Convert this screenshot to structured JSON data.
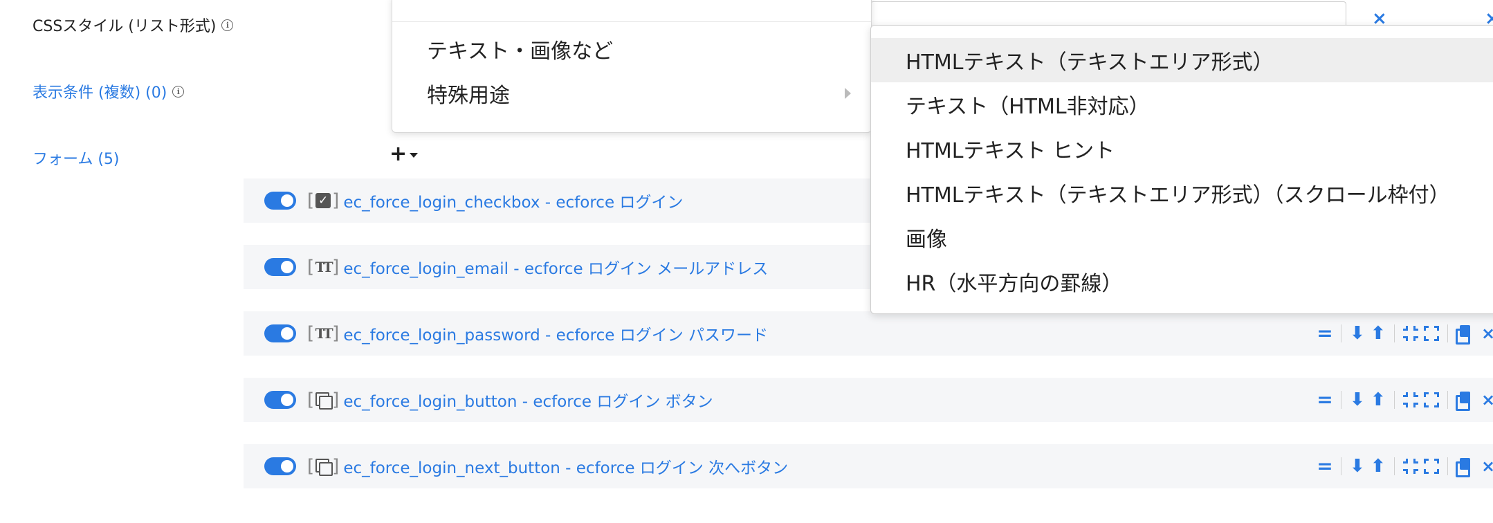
{
  "left_labels": {
    "css_style": "CSSスタイル (リスト形式)",
    "display_conditions": "表示条件 (複数) (0)",
    "forms": "フォーム (5)"
  },
  "icons": {
    "info": "i",
    "close": "×",
    "plus": "+"
  },
  "menu_primary": {
    "items": [
      {
        "label": "テキスト・画像など"
      },
      {
        "label": "特殊用途"
      }
    ]
  },
  "menu_submenu": {
    "items": [
      {
        "label": "HTMLテキスト（テキストエリア形式）",
        "highlighted": true
      },
      {
        "label": "テキスト（HTML非対応）"
      },
      {
        "label": "HTMLテキスト ヒント"
      },
      {
        "label": "HTMLテキスト（テキストエリア形式）（スクロール枠付）"
      },
      {
        "label": "画像"
      },
      {
        "label": "HR（水平方向の罫線）"
      }
    ]
  },
  "form_rows": [
    {
      "icon": "checkbox-icon",
      "label": "ec_force_login_checkbox - ecforce ログイン",
      "enabled": true
    },
    {
      "icon": "text-field-icon",
      "label": "ec_force_login_email - ecforce ログイン メールアドレス",
      "enabled": true
    },
    {
      "icon": "text-field-icon",
      "label": "ec_force_login_password - ecforce ログイン パスワード",
      "enabled": true
    },
    {
      "icon": "button-icon",
      "label": "ec_force_login_button - ecforce ログイン ボタン",
      "enabled": true
    },
    {
      "icon": "button-icon",
      "label": "ec_force_login_next_button - ecforce ログイン 次へボタン",
      "enabled": true
    }
  ],
  "row_actions": {
    "equals": "=",
    "down": "⬇",
    "up": "⬆"
  },
  "colors": {
    "accent": "#2a7ae2",
    "row_bg": "#f5f6f8",
    "highlight": "#eeeeee"
  }
}
